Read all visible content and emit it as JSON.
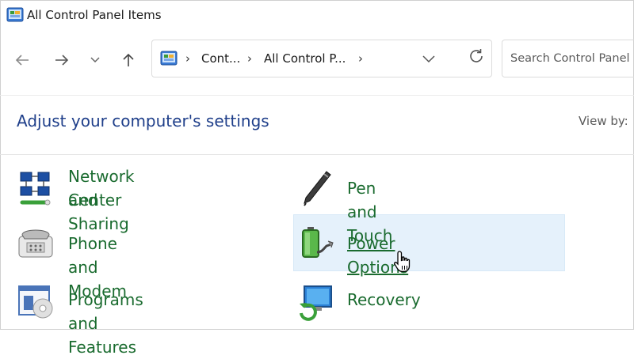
{
  "window": {
    "title": "All Control Panel Items"
  },
  "breadcrumb": {
    "items": [
      "Cont...",
      "All Control P..."
    ]
  },
  "search": {
    "placeholder": "Search Control Panel"
  },
  "main": {
    "heading": "Adjust your computer's settings",
    "view_by_label": "View by:"
  },
  "items": [
    {
      "label_line1": "Network and Sharing",
      "label_line2": "Center",
      "icon": "network-icon"
    },
    {
      "label": "Pen and Touch",
      "icon": "pen-icon"
    },
    {
      "label": "Phone and Modem",
      "icon": "phone-icon"
    },
    {
      "label": "Power Options",
      "icon": "battery-icon",
      "hovered": true
    },
    {
      "label": "Programs and Features",
      "icon": "programs-icon"
    },
    {
      "label": "Recovery",
      "icon": "recovery-icon"
    }
  ],
  "colors": {
    "link_green": "#1a6b2f",
    "heading_blue": "#1f3f8a",
    "hover_background": "#e5f1fb"
  }
}
